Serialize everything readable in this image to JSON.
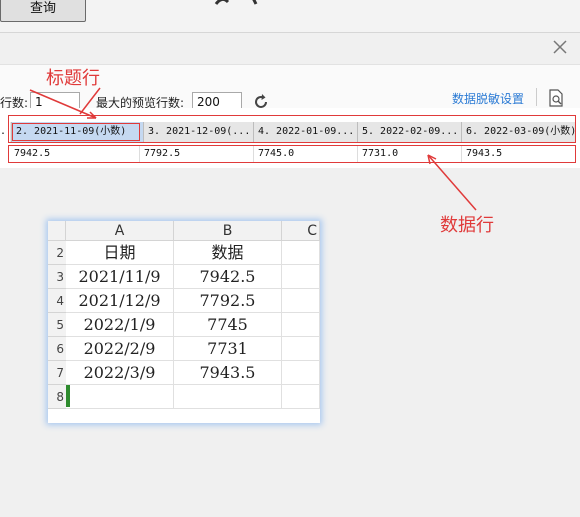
{
  "top": {
    "query_button": "查询"
  },
  "toolbar": {
    "row_label_partial": "行数:",
    "row_value": "1",
    "max_preview_label": "最大的预览行数:",
    "max_preview_value": "200",
    "desensitize_link": "数据脱敏设置"
  },
  "grid": {
    "headers": [
      ".",
      "2. 2021-11-09(小数)",
      "3. 2021-12-09(...",
      "4. 2022-01-09...",
      "5. 2022-02-09...",
      "6. 2022-03-09(小数)"
    ],
    "values": [
      "7942.5",
      "7792.5",
      "7745.0",
      "7731.0",
      "7943.5"
    ]
  },
  "annotations": {
    "header_row": "标题行",
    "data_row": "数据行"
  },
  "sheet": {
    "columns": [
      "A",
      "B",
      "C"
    ],
    "row_numbers": [
      "2",
      "3",
      "4",
      "5",
      "6",
      "7",
      "8"
    ],
    "rows": [
      [
        "日期",
        "数据"
      ],
      [
        "2021/11/9",
        "7942.5"
      ],
      [
        "2021/12/9",
        "7792.5"
      ],
      [
        "2022/1/9",
        "7745"
      ],
      [
        "2022/2/9",
        "7731"
      ],
      [
        "2022/3/9",
        "7943.5"
      ]
    ]
  },
  "colors": {
    "accent_red": "#e03a3a",
    "link_blue": "#2a7ad4",
    "selected_header": "#c5d9f1"
  }
}
